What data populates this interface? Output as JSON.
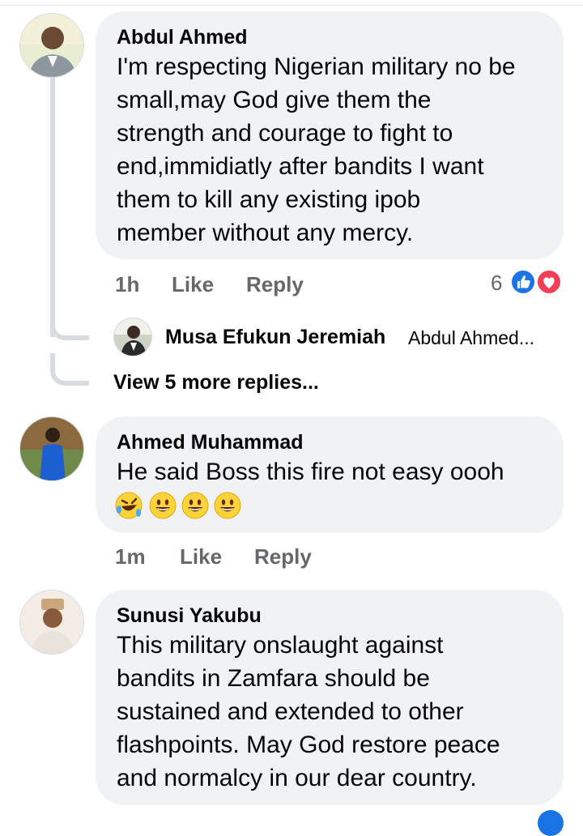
{
  "comments": [
    {
      "author": "Abdul Ahmed",
      "lines": [
        "I'm respecting Nigerian military no be",
        "small,may God give them the",
        "strength and courage to fight to",
        "end,immidiatly after bandits I want",
        "them to kill any existing  ipob",
        "member without any mercy."
      ],
      "time": "1h",
      "like": "Like",
      "reply": "Reply",
      "reaction_count": "6",
      "reactions": [
        "like-icon",
        "love-icon"
      ],
      "replies_preview": {
        "author": "Musa Efukun Jeremiah",
        "snippet": "Abdul Ahmed..."
      },
      "view_more": "View 5 more replies..."
    },
    {
      "author": "Ahmed Muhammad",
      "lines": [
        "He said Boss this fire not easy oooh"
      ],
      "emojis": [
        "rolling-laughing-emoji",
        "grinning-emoji",
        "grinning-emoji",
        "grinning-emoji"
      ],
      "time": "1m",
      "like": "Like",
      "reply": "Reply"
    },
    {
      "author": "Sunusi Yakubu",
      "lines": [
        "This military onslaught against",
        "bandits in Zamfara should be",
        "sustained and extended to other",
        "flashpoints. May God restore peace",
        "and normalcy in our dear country."
      ]
    }
  ],
  "colors": {
    "bubble": "#f0f2f5",
    "meta_text": "#65676b",
    "like_blue": "#1b74e4",
    "love_red": "#f33e58",
    "thread_line": "#d8dbdf"
  }
}
